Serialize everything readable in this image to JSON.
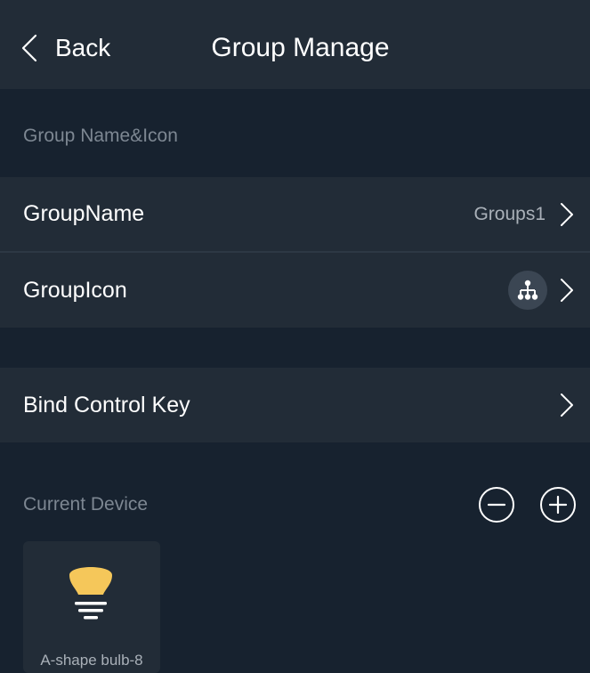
{
  "header": {
    "back_label": "Back",
    "title": "Group Manage"
  },
  "sections": {
    "name_icon_label": "Group Name&Icon",
    "current_device_label": "Current Device"
  },
  "rows": {
    "group_name": {
      "label": "GroupName",
      "value": "Groups1"
    },
    "group_icon": {
      "label": "GroupIcon",
      "icon": "group-hierarchy-icon"
    },
    "bind_control_key": {
      "label": "Bind Control Key"
    }
  },
  "devices": [
    {
      "name": "A-shape bulb-8",
      "icon": "bulb-icon",
      "icon_color": "#f5c75a"
    }
  ],
  "colors": {
    "background": "#17222f",
    "row_background": "#222c37",
    "muted_text": "#7d8792",
    "value_text": "#a9b0b8",
    "bulb": "#f5c75a"
  }
}
